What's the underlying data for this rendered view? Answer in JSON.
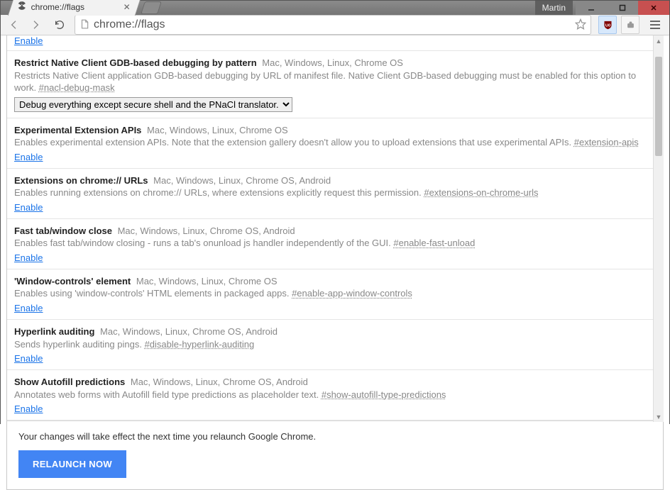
{
  "window": {
    "user": "Martin"
  },
  "tab": {
    "title": "chrome://flags"
  },
  "omnibox": {
    "url": "chrome://flags"
  },
  "partialTop": "Enable",
  "flags": [
    {
      "title": "Restrict Native Client GDB-based debugging by pattern",
      "platforms": "Mac, Windows, Linux, Chrome OS",
      "desc": "Restricts Native Client application GDB-based debugging by URL of manifest file. Native Client GDB-based debugging must be enabled for this option to work. ",
      "anchor": "#nacl-debug-mask",
      "type": "select",
      "selectValue": "Debug everything except secure shell and the PNaCl translator."
    },
    {
      "title": "Experimental Extension APIs",
      "platforms": "Mac, Windows, Linux, Chrome OS",
      "desc": "Enables experimental extension APIs. Note that the extension gallery doesn't allow you to upload extensions that use experimental APIs. ",
      "anchor": "#extension-apis",
      "type": "link",
      "action": "Enable"
    },
    {
      "title": "Extensions on chrome:// URLs",
      "platforms": "Mac, Windows, Linux, Chrome OS, Android",
      "desc": "Enables running extensions on chrome:// URLs, where extensions explicitly request this permission. ",
      "anchor": "#extensions-on-chrome-urls",
      "type": "link",
      "action": "Enable"
    },
    {
      "title": "Fast tab/window close",
      "platforms": "Mac, Windows, Linux, Chrome OS, Android",
      "desc": "Enables fast tab/window closing - runs a tab's onunload js handler independently of the GUI. ",
      "anchor": "#enable-fast-unload",
      "type": "link",
      "action": "Enable"
    },
    {
      "title": "'Window-controls' element",
      "platforms": "Mac, Windows, Linux, Chrome OS",
      "desc": "Enables using 'window-controls' HTML elements in packaged apps. ",
      "anchor": "#enable-app-window-controls",
      "type": "link",
      "action": "Enable"
    },
    {
      "title": "Hyperlink auditing",
      "platforms": "Mac, Windows, Linux, Chrome OS, Android",
      "desc": "Sends hyperlink auditing pings. ",
      "anchor": "#disable-hyperlink-auditing",
      "type": "link",
      "action": "Enable"
    },
    {
      "title": "Show Autofill predictions",
      "platforms": "Mac, Windows, Linux, Chrome OS, Android",
      "desc": "Annotates web forms with Autofill field type predictions as placeholder text. ",
      "anchor": "#show-autofill-type-predictions",
      "type": "link",
      "action": "Enable"
    }
  ],
  "footer": {
    "message": "Your changes will take effect the next time you relaunch Google Chrome.",
    "button": "RELAUNCH NOW"
  }
}
